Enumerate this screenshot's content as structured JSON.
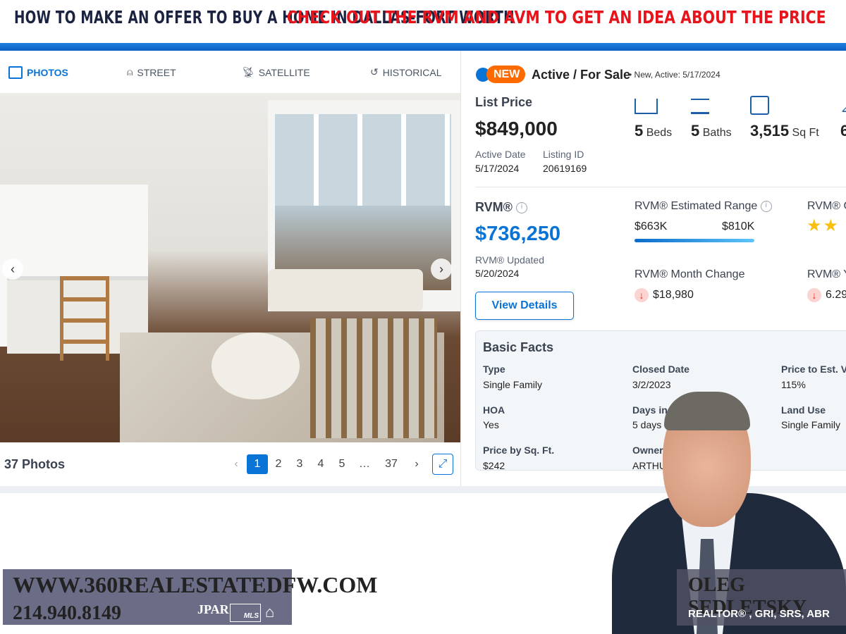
{
  "header": {
    "title_left": "HOW TO MAKE AN OFFER TO BUY A HOME IN DALLAS-FORT WORTH",
    "title_right": "CHECK OUT THE RVM AND AVM TO GET AN IDEA ABOUT THE PRICE"
  },
  "media_tabs": [
    {
      "label": "PHOTOS",
      "icon": "image-icon",
      "active": true
    },
    {
      "label": "STREET",
      "icon": "street-view-icon"
    },
    {
      "label": "SATELLITE",
      "icon": "satellite-icon"
    },
    {
      "label": "HISTORICAL",
      "icon": "history-icon"
    }
  ],
  "gallery": {
    "count_label": "37 Photos",
    "pages": [
      "1",
      "2",
      "3",
      "4",
      "5",
      "…",
      "37"
    ],
    "current_page": 1
  },
  "status": {
    "badge": "NEW",
    "text": "Active / For Sale",
    "detail": "• New, Active: 5/17/2024"
  },
  "listing": {
    "list_price_label": "List Price",
    "list_price": "$849,000",
    "active_date_label": "Active Date",
    "active_date": "5/17/2024",
    "listing_id_label": "Listing ID",
    "listing_id": "20619169"
  },
  "specs": [
    {
      "value": "5",
      "unit": "Beds",
      "icon": "bed-icon"
    },
    {
      "value": "5",
      "unit": "Baths",
      "icon": "bathtub-icon"
    },
    {
      "value": "3,515",
      "unit": "Sq Ft",
      "icon": "floorplan-icon"
    },
    {
      "value": "6",
      "unit": "",
      "icon": "lot-icon"
    }
  ],
  "rvm": {
    "label": "RVM®",
    "value": "$736,250",
    "updated_label": "RVM® Updated",
    "updated": "5/20/2024",
    "button": "View Details",
    "range_label": "RVM® Estimated Range",
    "range_low": "$663K",
    "range_high": "$810K",
    "confidence_label": "RVM® C",
    "confidence_stars": 2,
    "month_change_label": "RVM® Month Change",
    "month_change": "$18,980",
    "year_change_label": "RVM® Y",
    "year_change": "6.29"
  },
  "basic_facts": {
    "title": "Basic Facts",
    "items": [
      {
        "label": "Type",
        "value": "Single Family"
      },
      {
        "label": "Closed Date",
        "value": "3/2/2023"
      },
      {
        "label": "Price to Est. V",
        "value": "115%"
      },
      {
        "label": "HOA",
        "value": "Yes"
      },
      {
        "label": "Days in R",
        "value": "5 days"
      },
      {
        "label": "Land Use",
        "value": "Single Family"
      },
      {
        "label": "Price by Sq. Ft.",
        "value": "$242"
      },
      {
        "label": "Owner",
        "value": "ARTHU"
      }
    ]
  },
  "branding": {
    "website": "WWW.360REALESTATEDFW.COM",
    "phone": "214.940.8149",
    "logos": "JPAR REALTOR MLS EQUAL HOUSING OPPORTUNITY",
    "agent_name": "OLEG SEDLETSKY",
    "agent_title": "REALTOR® , GRI, SRS, ABR"
  },
  "colors": {
    "accent": "#0a74d6",
    "new_badge": "#ff6a00",
    "header_red": "#e8141b",
    "header_navy": "#1b2340"
  }
}
